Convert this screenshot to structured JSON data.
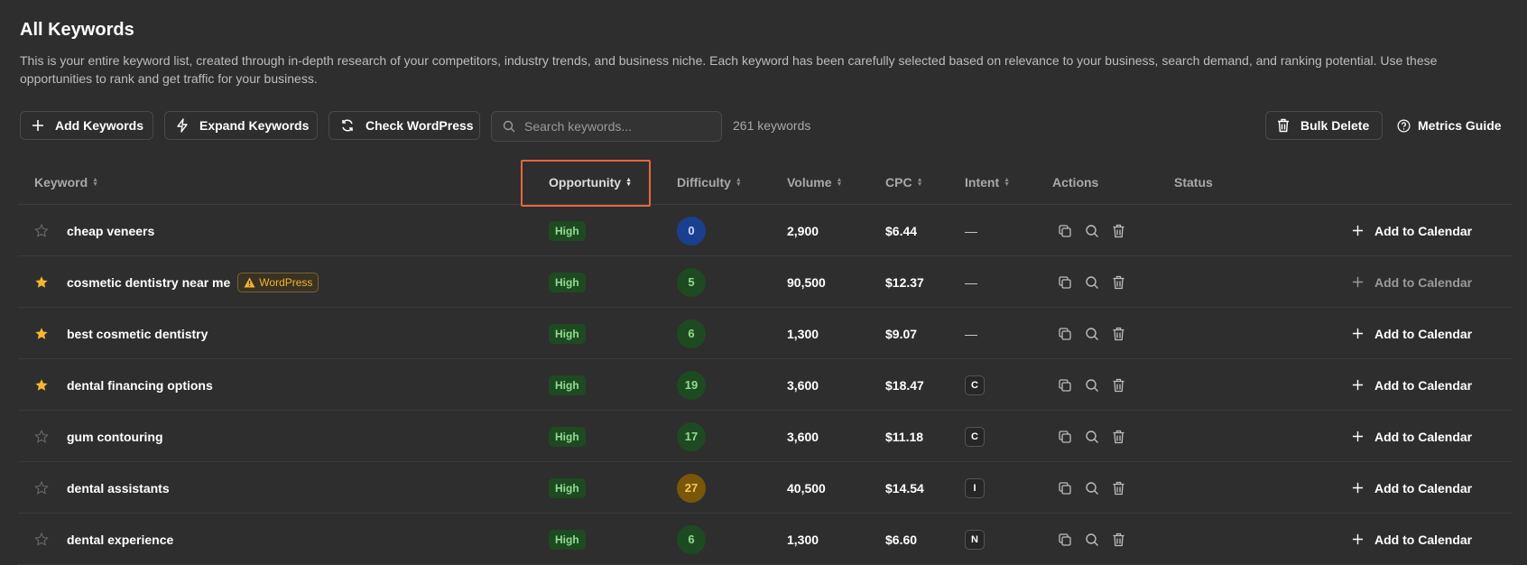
{
  "page": {
    "title": "All Keywords",
    "description": "This is your entire keyword list, created through in-depth research of your competitors, industry trends, and business niche. Each keyword has been carefully selected based on relevance to your business, search demand, and ranking potential. Use these opportunities to rank and get traffic for your business."
  },
  "toolbar": {
    "add_keywords": "Add Keywords",
    "expand_keywords": "Expand Keywords",
    "check_wordpress": "Check WordPress",
    "search_placeholder": "Search keywords...",
    "keyword_count": "261 keywords",
    "bulk_delete": "Bulk Delete",
    "metrics_guide": "Metrics Guide"
  },
  "table": {
    "headers": {
      "keyword": "Keyword",
      "opportunity": "Opportunity",
      "difficulty": "Difficulty",
      "volume": "Volume",
      "cpc": "CPC",
      "intent": "Intent",
      "actions": "Actions",
      "status": "Status"
    },
    "rows": [
      {
        "starred": false,
        "keyword": "cheap veneers",
        "wordpress": "",
        "opportunity": "High",
        "difficulty": "0",
        "difficulty_color": "#1b3f8f",
        "difficulty_text": "#cfd9ff",
        "volume": "2,900",
        "cpc": "$6.44",
        "intent": "—",
        "calendar": "Add to Calendar",
        "calendar_dim": false
      },
      {
        "starred": true,
        "keyword": "cosmetic dentistry near me",
        "wordpress": "WordPress",
        "opportunity": "High",
        "difficulty": "5",
        "difficulty_color": "#1e4a22",
        "difficulty_text": "#8fdc8f",
        "volume": "90,500",
        "cpc": "$12.37",
        "intent": "—",
        "calendar": "Add to Calendar",
        "calendar_dim": true
      },
      {
        "starred": true,
        "keyword": "best cosmetic dentistry",
        "wordpress": "",
        "opportunity": "High",
        "difficulty": "6",
        "difficulty_color": "#1e4a22",
        "difficulty_text": "#8fdc8f",
        "volume": "1,300",
        "cpc": "$9.07",
        "intent": "—",
        "calendar": "Add to Calendar",
        "calendar_dim": false
      },
      {
        "starred": true,
        "keyword": "dental financing options",
        "wordpress": "",
        "opportunity": "High",
        "difficulty": "19",
        "difficulty_color": "#1e4a22",
        "difficulty_text": "#8fdc8f",
        "volume": "3,600",
        "cpc": "$18.47",
        "intent": "C",
        "calendar": "Add to Calendar",
        "calendar_dim": false
      },
      {
        "starred": false,
        "keyword": "gum contouring",
        "wordpress": "",
        "opportunity": "High",
        "difficulty": "17",
        "difficulty_color": "#1e4a22",
        "difficulty_text": "#8fdc8f",
        "volume": "3,600",
        "cpc": "$11.18",
        "intent": "C",
        "calendar": "Add to Calendar",
        "calendar_dim": false
      },
      {
        "starred": false,
        "keyword": "dental assistants",
        "wordpress": "",
        "opportunity": "High",
        "difficulty": "27",
        "difficulty_color": "#7a5608",
        "difficulty_text": "#f3c75c",
        "volume": "40,500",
        "cpc": "$14.54",
        "intent": "I",
        "calendar": "Add to Calendar",
        "calendar_dim": false
      },
      {
        "starred": false,
        "keyword": "dental experience",
        "wordpress": "",
        "opportunity": "High",
        "difficulty": "6",
        "difficulty_color": "#1e4a22",
        "difficulty_text": "#8fdc8f",
        "volume": "1,300",
        "cpc": "$6.60",
        "intent": "N",
        "calendar": "Add to Calendar",
        "calendar_dim": false
      }
    ]
  },
  "colors": {
    "highlight_border": "#e8663a",
    "star_active": "#f5b731",
    "star_inactive": "#6a6a6a"
  }
}
